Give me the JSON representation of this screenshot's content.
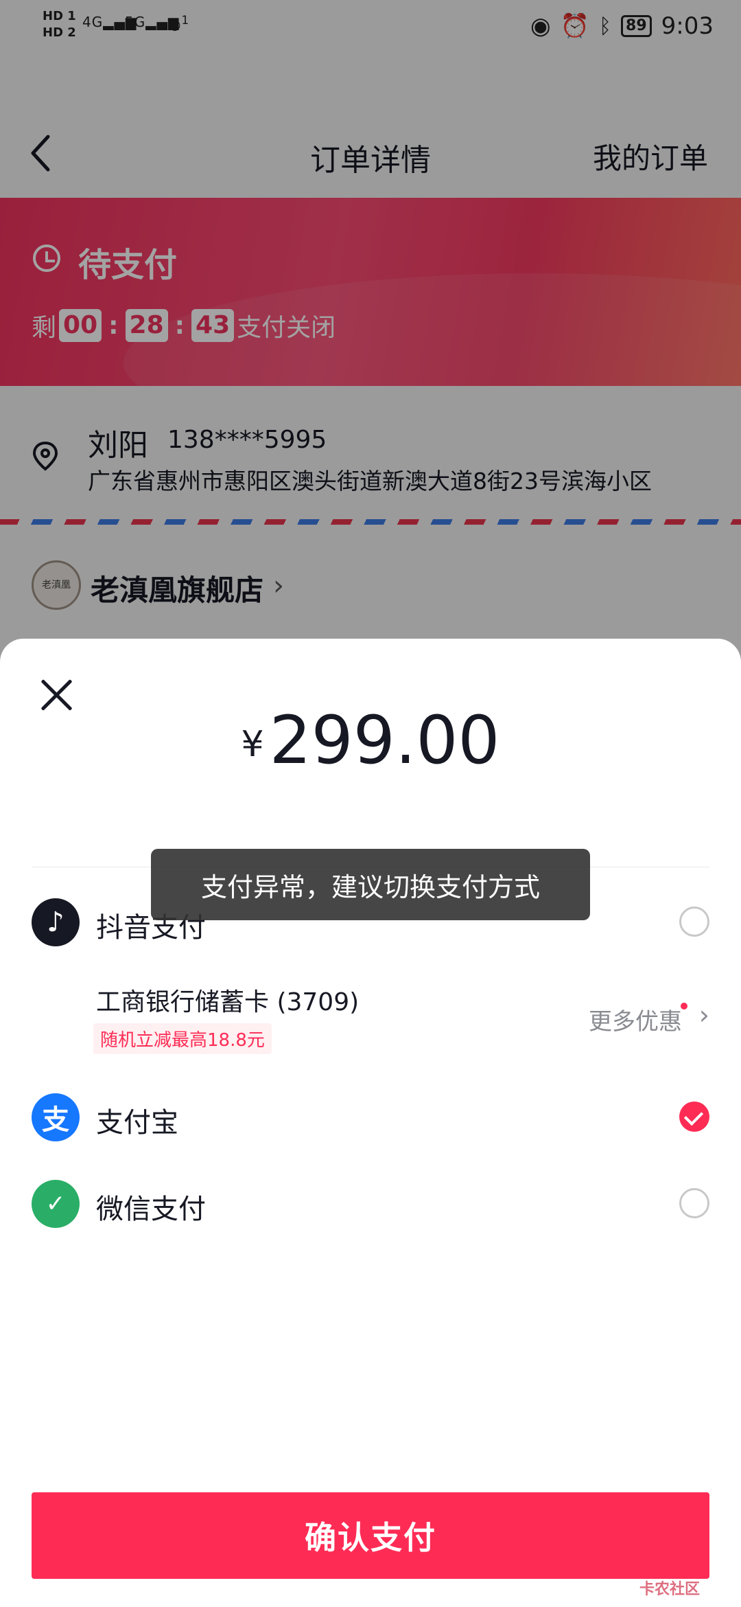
{
  "status_bar": {
    "hd1": "HD 1",
    "hd2": "HD 2",
    "sig1": "4G",
    "sig2": "5G",
    "hotspot": "1",
    "battery": "89",
    "time": "9:03"
  },
  "nav": {
    "title": "订单详情",
    "right_link": "我的订单"
  },
  "order_status": {
    "label": "待支付",
    "prefix": "剩",
    "hours": "00",
    "minutes": "28",
    "seconds": "43",
    "suffix": "支付关闭"
  },
  "address": {
    "name": "刘阳",
    "phone": "138****5995",
    "full": "广东省惠州市惠阳区澳头街道新澳大道8街23号滨海小区"
  },
  "shop": {
    "logo_text": "老滇凰",
    "name": "老滇凰旗舰店"
  },
  "payment": {
    "currency": "¥",
    "amount": "299.00",
    "methods": [
      {
        "label": "抖音支付",
        "icon": "douyin-icon",
        "selected": false
      },
      {
        "label": "支付宝",
        "icon": "alipay-icon",
        "selected": true
      },
      {
        "label": "微信支付",
        "icon": "wechat-pay-icon",
        "selected": false
      }
    ],
    "bank_card": "工商银行储蓄卡 (3709)",
    "promo": "随机立减最高18.8元",
    "more_offers": "更多优惠",
    "confirm": "确认支付"
  },
  "toast": "支付异常，建议切换支付方式",
  "watermark": "卡农社区",
  "colors": {
    "accent": "#fe2c55",
    "alipay": "#1677ff",
    "wechat": "#2aae67",
    "douyin": "#161823"
  }
}
